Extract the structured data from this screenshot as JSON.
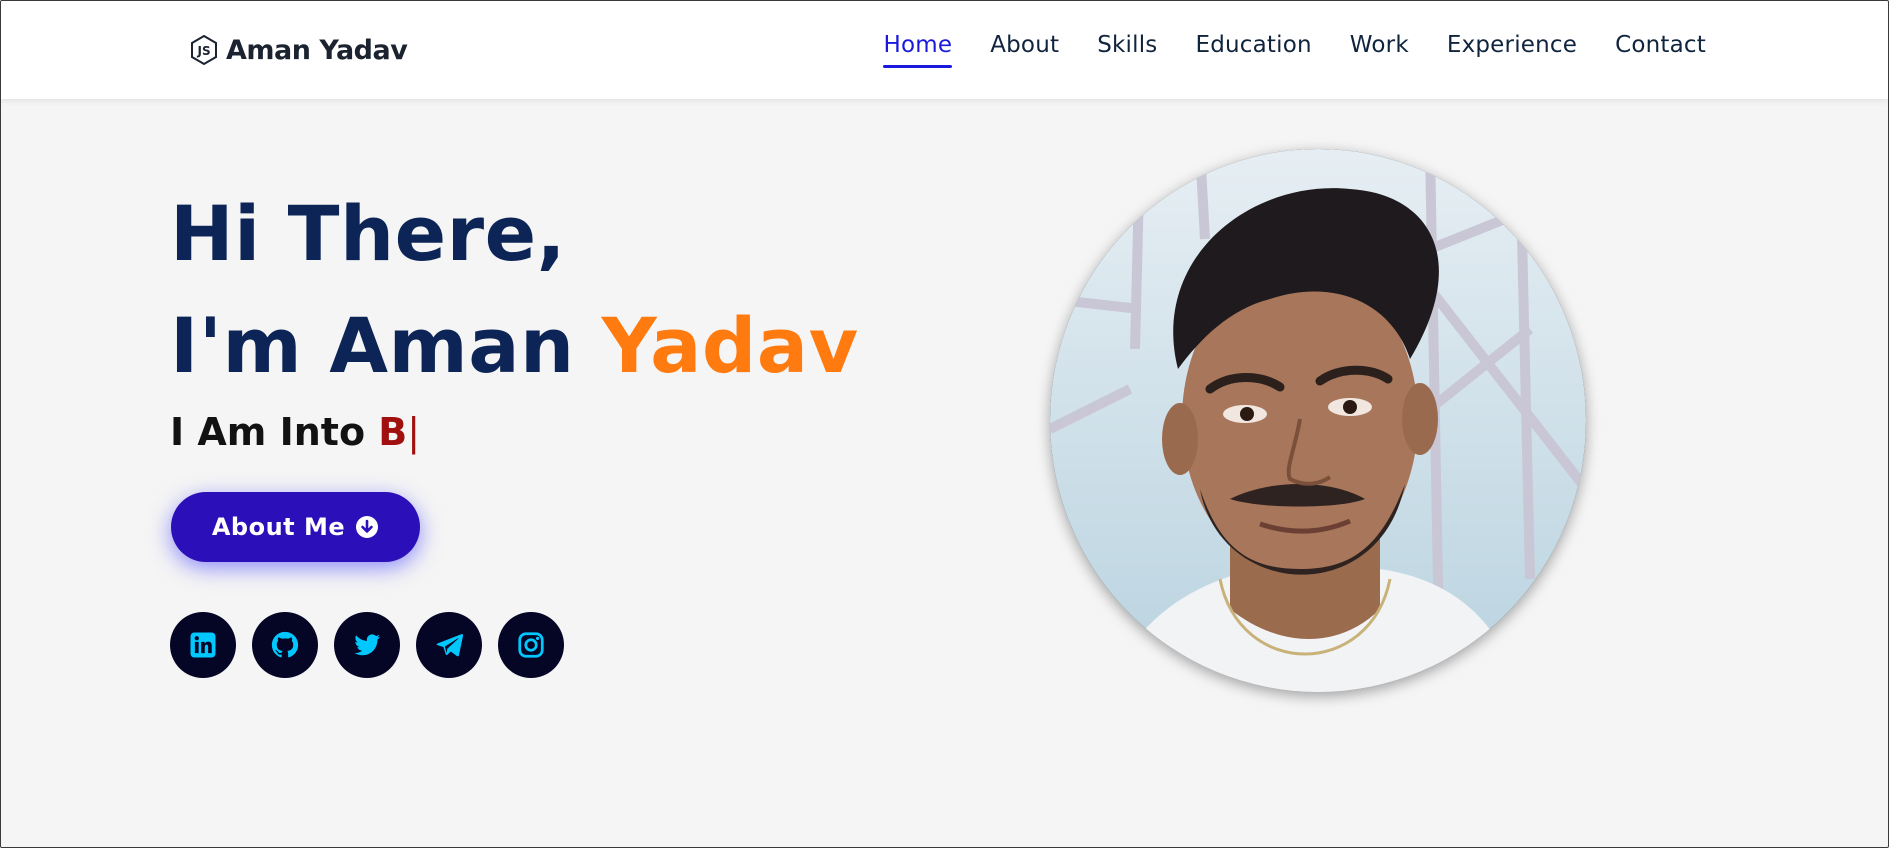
{
  "header": {
    "logo_text": "Aman Yadav",
    "nav": [
      "Home",
      "About",
      "Skills",
      "Education",
      "Work",
      "Experience",
      "Contact"
    ],
    "active_nav": "Home"
  },
  "hero": {
    "line1": "Hi There,",
    "line2_prefix": "I'm Aman ",
    "line2_accent": "Yadav",
    "typing_prefix": "I Am Into ",
    "typing_text": "B",
    "typing_cursor": "|",
    "about_button": "About Me"
  },
  "socials": [
    "linkedin-icon",
    "github-icon",
    "twitter-icon",
    "telegram-icon",
    "instagram-icon"
  ],
  "colors": {
    "nav_active": "#1a1adf",
    "heading": "#0c2556",
    "accent": "#ff7a0f",
    "typing": "#a10f0f",
    "button": "#2b0fb9",
    "social_bg": "#050525",
    "social_icon": "#00c8ff"
  }
}
